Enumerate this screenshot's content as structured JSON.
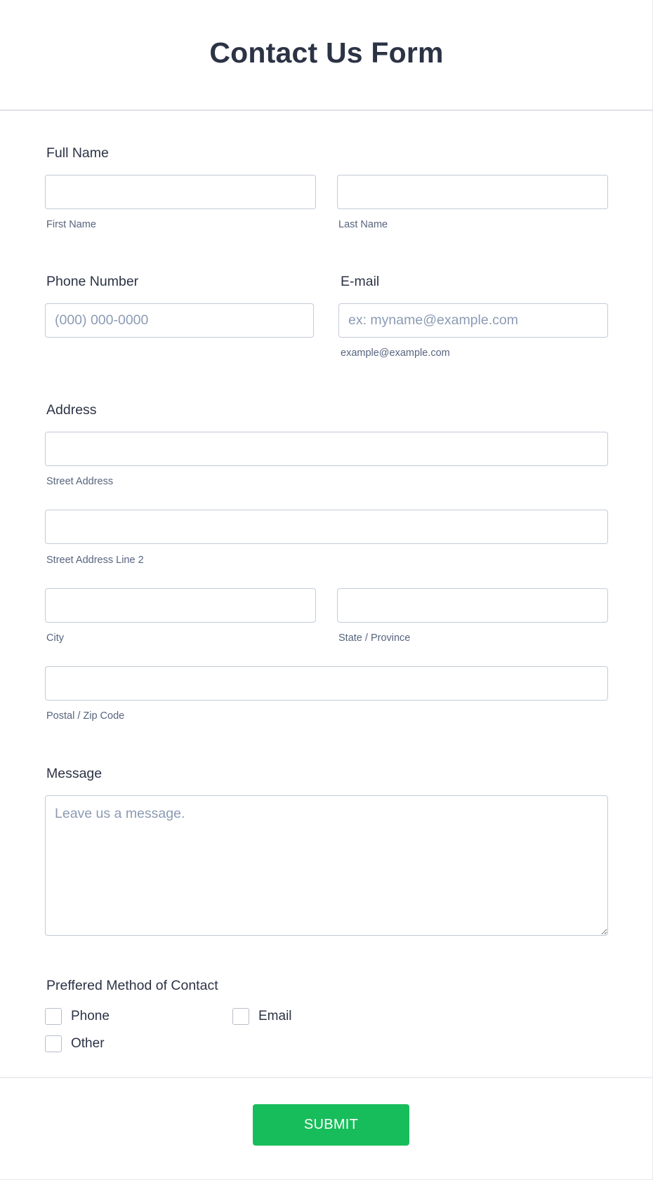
{
  "form": {
    "title": "Contact Us Form",
    "full_name": {
      "label": "Full Name",
      "first": {
        "sublabel": "First Name",
        "value": "",
        "placeholder": ""
      },
      "last": {
        "sublabel": "Last Name",
        "value": "",
        "placeholder": ""
      }
    },
    "phone": {
      "label": "Phone Number",
      "value": "",
      "placeholder": "(000) 000-0000"
    },
    "email": {
      "label": "E-mail",
      "value": "",
      "placeholder": "ex: myname@example.com",
      "sublabel": "example@example.com"
    },
    "address": {
      "label": "Address",
      "street": {
        "sublabel": "Street Address",
        "value": ""
      },
      "street2": {
        "sublabel": "Street Address Line 2",
        "value": ""
      },
      "city": {
        "sublabel": "City",
        "value": ""
      },
      "state": {
        "sublabel": "State / Province",
        "value": ""
      },
      "zip": {
        "sublabel": "Postal / Zip Code",
        "value": ""
      }
    },
    "message": {
      "label": "Message",
      "value": "",
      "placeholder": "Leave us a message."
    },
    "contact_method": {
      "label": "Preffered Method of Contact",
      "options": [
        {
          "label": "Phone",
          "checked": false
        },
        {
          "label": "Email",
          "checked": false
        },
        {
          "label": "Other",
          "checked": false
        }
      ]
    },
    "submit_label": "SUBMIT",
    "colors": {
      "accent": "#18bd5b",
      "text": "#2c3345",
      "sublabel": "#57647e",
      "border": "#c3cad8"
    }
  }
}
